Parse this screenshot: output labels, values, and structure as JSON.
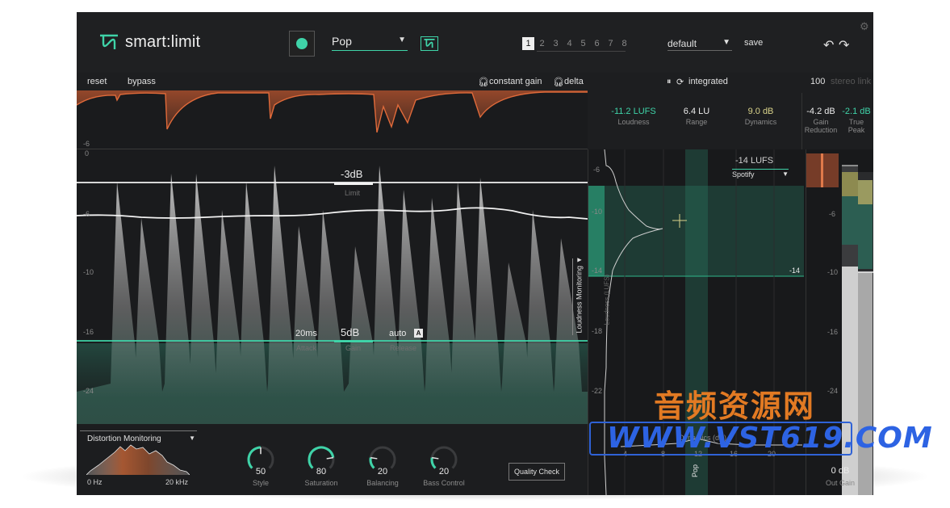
{
  "app": {
    "name": "smart:limit"
  },
  "header": {
    "profile": "Pop",
    "presets": [
      "1",
      "2",
      "3",
      "4",
      "5",
      "6",
      "7",
      "8"
    ],
    "active_preset": "1",
    "default_label": "default",
    "save_label": "save"
  },
  "toolbar": {
    "reset": "reset",
    "bypass": "bypass",
    "constant_gain": "constant gain",
    "delta": "delta",
    "integrated": "integrated",
    "stereo_link_value": "100",
    "stereo_link_label": "stereo link"
  },
  "metrics": [
    {
      "value": "-11.2 LUFS",
      "label": "Loudness"
    },
    {
      "value": "6.4 LU",
      "label": "Range"
    },
    {
      "value": "9.0 dB",
      "label": "Dynamics"
    },
    {
      "value": "-4.2 dB",
      "label": "Gain\nReduction"
    },
    {
      "value": "-2.1 dB",
      "label": "True\nPeak"
    }
  ],
  "gr_strip": {
    "scale_label": "-6"
  },
  "waveform": {
    "scale": [
      "0",
      "-6",
      "-10",
      "-16",
      "-24"
    ],
    "limit": {
      "value": "-3dB",
      "label": "Limit"
    },
    "attack": {
      "value": "20ms",
      "label": "Attack"
    },
    "gain": {
      "value": "5dB",
      "label": "Gain"
    },
    "release": {
      "value": "auto",
      "label": "Release",
      "auto_badge": "A"
    },
    "loudness_monitoring": "Loudness Monitoring"
  },
  "loudness_panel": {
    "target": "-14 LUFS",
    "platform": "Spotify",
    "scale": [
      "-6",
      "-10",
      "-14",
      "-18",
      "-22"
    ],
    "target_marker": "-14",
    "y_label": "Loudness (LUFS)",
    "x_label": "Dynamics (dB)",
    "x_ticks": [
      "4",
      "8",
      "12",
      "16",
      "20"
    ],
    "genre": "Pop"
  },
  "meter_panel": {
    "scale": [
      "-6",
      "-10",
      "-16",
      "-24"
    ],
    "out_gain_value": "0 dB",
    "out_gain_label": "Out Gain"
  },
  "distortion": {
    "selector": "Distortion Monitoring",
    "freq_low": "0 Hz",
    "freq_high": "20 kHz"
  },
  "knobs": [
    {
      "value": "50",
      "label": "Style",
      "fraction": 0.5
    },
    {
      "value": "80",
      "label": "Saturation",
      "fraction": 0.8
    },
    {
      "value": "20",
      "label": "Balancing",
      "fraction": 0.2
    },
    {
      "value": "20",
      "label": "Bass Control",
      "fraction": 0.2
    }
  ],
  "quality_check": "Quality Check",
  "watermark": {
    "cn": "音频资源网",
    "url": "WWW.VST619.COM"
  },
  "colors": {
    "accent": "#3fd3a8",
    "gr": "#e06a3a",
    "dynamics": "#d9d38a"
  }
}
